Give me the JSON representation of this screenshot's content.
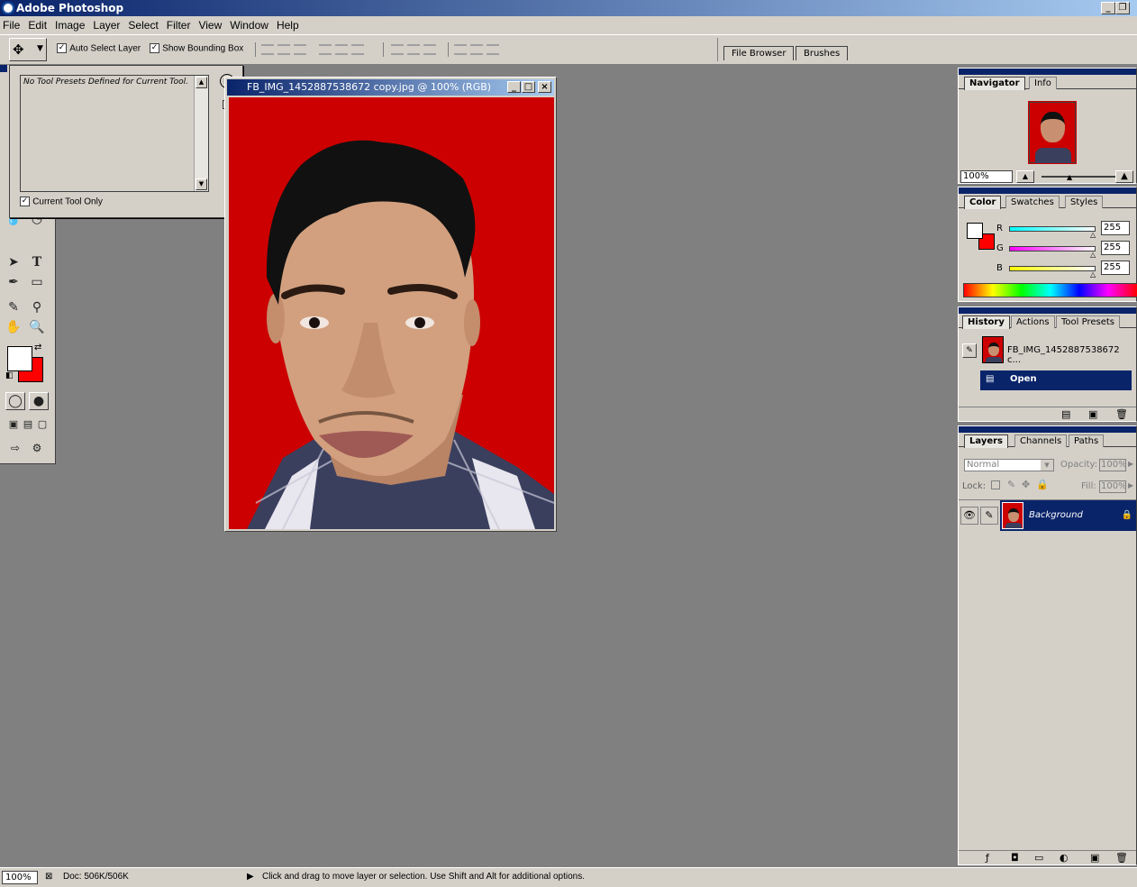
{
  "app": {
    "title": "Adobe Photoshop"
  },
  "menu": [
    "File",
    "Edit",
    "Image",
    "Layer",
    "Select",
    "Filter",
    "View",
    "Window",
    "Help"
  ],
  "options": {
    "auto_select_layer": "Auto Select Layer",
    "show_bounding_box": "Show Bounding Box",
    "auto_select_checked": true,
    "bounding_box_checked": true
  },
  "palette_well": {
    "file_browser": "File Browser",
    "brushes": "Brushes"
  },
  "presets": {
    "empty_message": "No Tool Presets Defined for Current Tool.",
    "current_tool_only": "Current Tool Only"
  },
  "document": {
    "title": "FB_IMG_1452887538672 copy.jpg @ 100% (RGB)"
  },
  "navigator": {
    "tabs": [
      "Navigator",
      "Info"
    ],
    "zoom": "100%"
  },
  "color": {
    "tabs": [
      "Color",
      "Swatches",
      "Styles"
    ],
    "channels": [
      {
        "label": "R",
        "value": "255",
        "gradient": "linear-gradient(to right,#00ffff,#ffffff)"
      },
      {
        "label": "G",
        "value": "255",
        "gradient": "linear-gradient(to right,#ff00ff,#ffffff)"
      },
      {
        "label": "B",
        "value": "255",
        "gradient": "linear-gradient(to right,#ffff00,#ffffff)"
      }
    ],
    "foreground": "#ffffff",
    "background": "#ff0000"
  },
  "history": {
    "tabs": [
      "History",
      "Actions",
      "Tool Presets"
    ],
    "snapshot": "FB_IMG_1452887538672 c...",
    "step": "Open"
  },
  "layers": {
    "tabs": [
      "Layers",
      "Channels",
      "Paths"
    ],
    "blend_mode": "Normal",
    "opacity_label": "Opacity:",
    "opacity": "100%",
    "lock_label": "Lock:",
    "fill_label": "Fill:",
    "fill": "100%",
    "layer_name": "Background"
  },
  "status": {
    "zoom": "100%",
    "doc": "Doc: 506K/506K",
    "hint": "Click and drag to move layer or selection.  Use Shift and Alt for additional options."
  }
}
